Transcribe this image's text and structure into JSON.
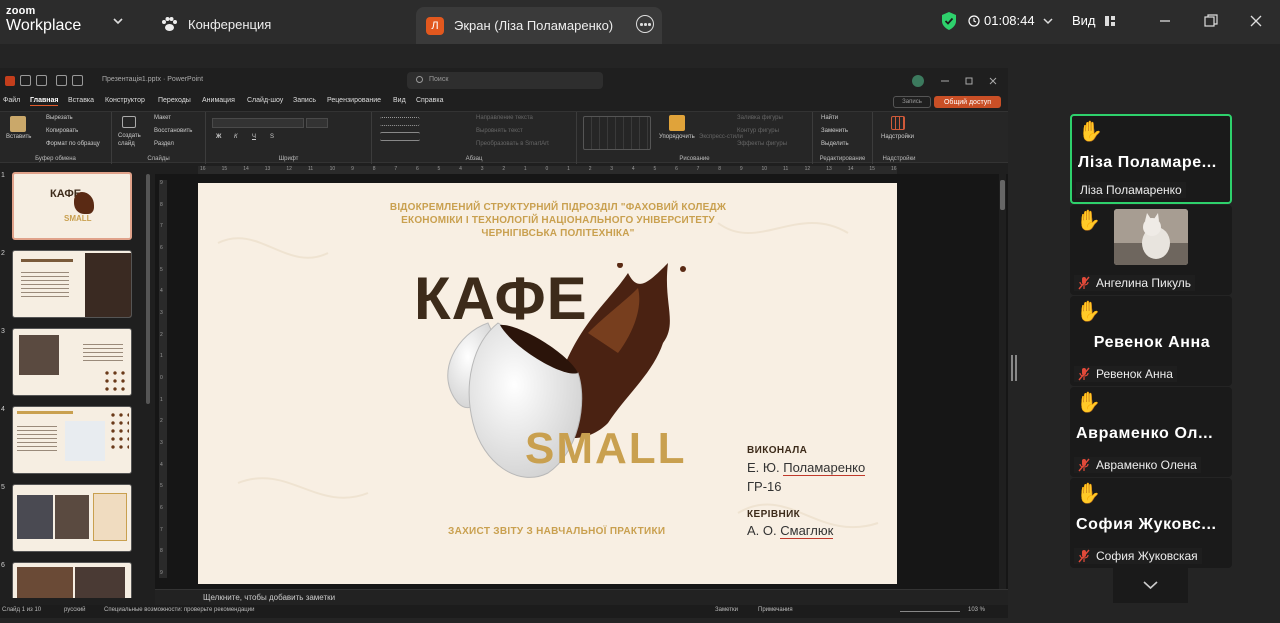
{
  "zoom": {
    "logo_line1": "zoom",
    "logo_line2": "Workplace",
    "conference_label": "Конференция",
    "screen_tab": {
      "avatar_letter": "Л",
      "title": "Экран (Ліза Поламаренко)"
    },
    "timer": "01:08:44",
    "view_label": "Вид",
    "accent": "#2ed16c"
  },
  "powerpoint": {
    "file_name": "Презентація1.pptx · PowerPoint",
    "search_placeholder": "Поиск",
    "menu": [
      "Файл",
      "Главная",
      "Вставка",
      "Конструктор",
      "Переходы",
      "Анимация",
      "Слайд-шоу",
      "Запись",
      "Рецензирование",
      "Вид",
      "Справка"
    ],
    "active_menu": "Главная",
    "record_label": "Запись",
    "share_label": "Общий доступ",
    "ribbon": {
      "clipboard": {
        "paste": "Вставить",
        "cut": "Вырезать",
        "copy": "Копировать",
        "format_painter": "Формат по образцу",
        "group": "Буфер обмена"
      },
      "slides": {
        "new_slide": "Создать слайд",
        "layout": "Макет",
        "reset": "Восстановить",
        "section": "Раздел",
        "group": "Слайды"
      },
      "font": {
        "group": "Шрифт",
        "bold": "Ж",
        "italic": "К",
        "underline": "Ч",
        "strike": "S"
      },
      "paragraph": {
        "text_direction": "Направление текста",
        "align_text": "Выровнять текст",
        "smartart": "Преобразовать в SmartArt",
        "group": "Абзац"
      },
      "drawing": {
        "arrange": "Упорядочить",
        "quick_styles": "Экспресс-стили",
        "shape_fill": "Заливка фигуры",
        "shape_outline": "Контур фигуры",
        "shape_effects": "Эффекты фигуры",
        "group": "Рисование"
      },
      "editing": {
        "find": "Найти",
        "replace": "Заменить",
        "select": "Выделить",
        "group": "Редактирование"
      },
      "addins": {
        "label": "Надстройки",
        "group": "Надстройки"
      }
    },
    "ruler_ticks": [
      "16",
      "15",
      "14",
      "13",
      "12",
      "11",
      "10",
      "9",
      "8",
      "7",
      "6",
      "5",
      "4",
      "3",
      "2",
      "1",
      "0",
      "1",
      "2",
      "3",
      "4",
      "5",
      "6",
      "7",
      "8",
      "9",
      "10",
      "11",
      "12",
      "13",
      "14",
      "15",
      "16"
    ],
    "vruler_ticks": [
      "9",
      "8",
      "7",
      "6",
      "5",
      "4",
      "3",
      "2",
      "1",
      "0",
      "1",
      "2",
      "3",
      "4",
      "5",
      "6",
      "7",
      "8",
      "9"
    ],
    "thumbnails": [
      {
        "num": "1"
      },
      {
        "num": "2"
      },
      {
        "num": "3"
      },
      {
        "num": "4"
      },
      {
        "num": "5"
      },
      {
        "num": "6"
      }
    ],
    "notes_placeholder": "Щелкните, чтобы добавить заметки",
    "status": {
      "slide_count": "Слайд 1 из 10",
      "language": "русский",
      "accessibility": "Специальные возможности: проверьте рекомендации",
      "notes": "Заметки",
      "comments": "Примечания",
      "zoom_level": "103 %"
    }
  },
  "slide": {
    "institution": "ВІДОКРЕМЛЕНИЙ СТРУКТУРНИЙ ПІДРОЗДІЛ \"ФАХОВИЙ КОЛЕДЖ ЕКОНОМІКИ І ТЕХНОЛОГІЙ НАЦІОНАЛЬНОГО УНІВЕРСИТЕТУ ЧЕРНІГІВСЬКА ПОЛІТЕХНІКА\"",
    "title_word": "КАФЕ",
    "subtitle_word": "SMALL",
    "performed_label": "ВИКОНАЛА",
    "performed_initials": "Е. Ю.",
    "performed_surname": "Поламаренко",
    "group": "ГР-16",
    "supervisor_label": "КЕРІВНИК",
    "supervisor_initials": "А. О.",
    "supervisor_surname": "Смаглюк",
    "defense": "ЗАХИСТ ЗВІТУ З НАВЧАЛЬНОЇ ПРАКТИКИ",
    "gold": "#c9a04f",
    "brown": "#3d2b1a"
  },
  "participants": [
    {
      "big": "Ліза Поламаре...",
      "name": "Ліза Поламаренко",
      "muted": false,
      "active": true
    },
    {
      "big": "",
      "name": "Ангелина Пикуль",
      "muted": true,
      "video": true
    },
    {
      "big": "Ревенок Анна",
      "name": "Ревенок Анна",
      "muted": true
    },
    {
      "big": "Авраменко Ол...",
      "name": "Авраменко Олена",
      "muted": true
    },
    {
      "big": "София Жуковс...",
      "name": "София Жуковская",
      "muted": true
    }
  ]
}
